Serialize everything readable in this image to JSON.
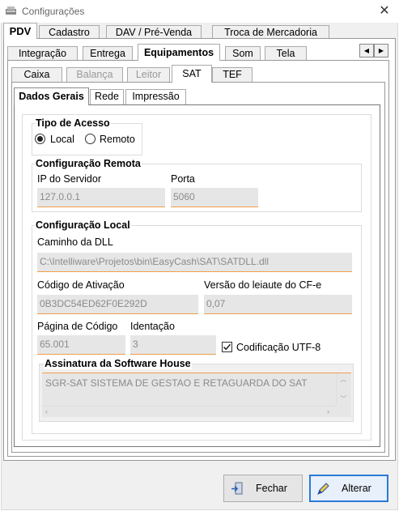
{
  "window": {
    "title": "Configurações"
  },
  "tabs_level1": [
    "PDV",
    "Cadastro",
    "DAV / Pré-Venda",
    "Troca de Mercadoria"
  ],
  "tabs_level2": [
    "Integração",
    "Entrega",
    "Equipamentos",
    "Som",
    "Tela"
  ],
  "scroll_arrows": {
    "left": "◀",
    "right": "▶"
  },
  "tabs_level3": [
    "Caixa",
    "Balança",
    "Leitor",
    "SAT",
    "TEF"
  ],
  "tabs_level4": [
    "Dados Gerais",
    "Rede",
    "Impressão"
  ],
  "tipo_acesso": {
    "title": "Tipo de Acesso",
    "option_local": "Local",
    "option_remoto": "Remoto",
    "selected": "Local"
  },
  "config_remota": {
    "title": "Configuração Remota",
    "ip_label": "IP do Servidor",
    "ip_value": "127.0.0.1",
    "porta_label": "Porta",
    "porta_value": "5060"
  },
  "config_local": {
    "title": "Configuração Local",
    "dll_label": "Caminho da DLL",
    "dll_value": "C:\\Intelliware\\Projetos\\bin\\EasyCash\\SAT\\SATDLL.dll",
    "ativacao_label": "Código de Ativação",
    "ativacao_value": "0B3DC54ED62F0E292D",
    "versao_label": "Versão do leiaute do CF-e",
    "versao_value": "0,07",
    "pagina_label": "Página de Código",
    "pagina_value": "65.001",
    "identacao_label": "Identação",
    "identacao_value": "3",
    "utf8_label": "Codificação UTF-8",
    "utf8_checked": true
  },
  "assinatura": {
    "title": "Assinatura da Software House",
    "value": "SGR-SAT SISTEMA DE GESTAO E RETAGUARDA DO SAT"
  },
  "buttons": {
    "fechar": "Fechar",
    "alterar": "Alterar"
  },
  "colors": {
    "accent": "#f29e4c",
    "field_bg": "#e6e6e6",
    "selected_border": "#2a7ad5"
  }
}
